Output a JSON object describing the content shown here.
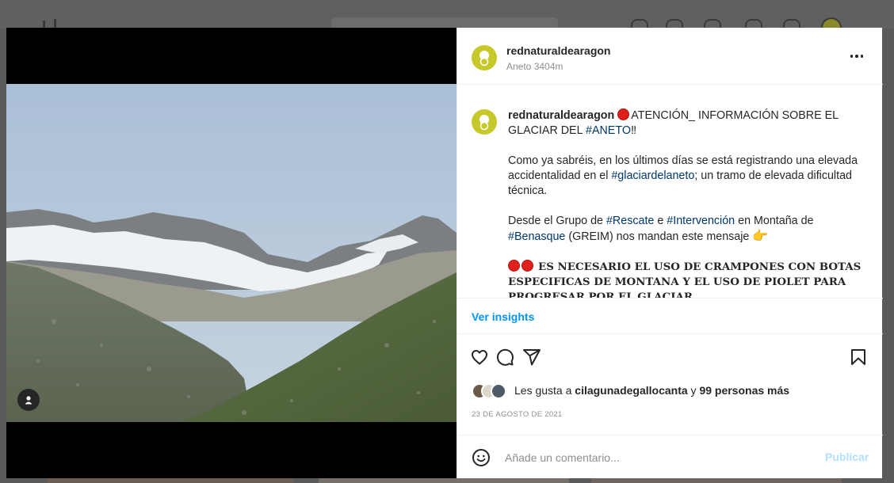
{
  "post": {
    "username": "rednaturaldearagon",
    "location": "Aneto 3404m",
    "avatar_color": "#c7c92b"
  },
  "caption": {
    "username": "rednaturaldearagon",
    "line1_text": "ATENCIÓN_ INFORMACIÓN SOBRE EL GLACIAR DEL ",
    "line1_tag": "#ANETO",
    "line1_end": "‼",
    "p2_a": "Como ya sabréis, en los últimos días se está registrando una elevada accidentalidad en el ",
    "p2_tag": "#glaciardelaneto",
    "p2_b": "; un tramo de elevada dificultad técnica.",
    "p3_a": "Desde el Grupo de ",
    "p3_tag1": "#Rescate",
    "p3_b": " e ",
    "p3_tag2": "#Intervención",
    "p3_c": " en Montaña de ",
    "p3_tag3": "#Benasque",
    "p3_d": " (GREIM) nos mandan este mensaje ",
    "p3_emoji": "👉",
    "p4_text": "ES NECESARIO EL USO DE CRAMPONES CON BOTAS ESPECIFICAS DE MONTANA Y EL USO DE PIOLET PARA PROGRESAR POR EL GLACIAR"
  },
  "insights_label": "Ver insights",
  "likes": {
    "prefix": "Les gusta a ",
    "user": "cilagunadegallocanta",
    "middle": " y ",
    "others": "99 personas más"
  },
  "date": "23 DE AGOSTO DE 2021",
  "comment": {
    "placeholder": "Añade un comentario...",
    "publish_label": "Publicar"
  },
  "icons": [
    "heart-icon",
    "comment-icon",
    "share-icon",
    "save-icon",
    "emoji-icon",
    "more-icon",
    "user-tag-icon"
  ],
  "colors": {
    "link_blue": "#0095f6",
    "hashtag": "#00376b",
    "publish_disabled": "#b2dffc",
    "alert_red": "#e0201b"
  }
}
